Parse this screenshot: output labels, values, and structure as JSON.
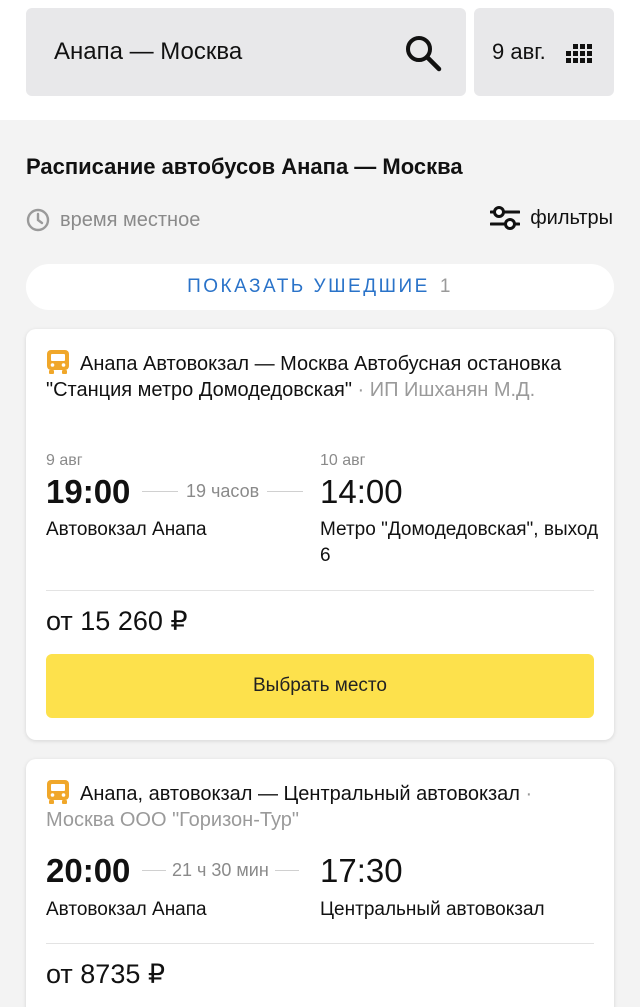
{
  "search": {
    "route": "Анапа — Москва",
    "date": "9 авг."
  },
  "page": {
    "title": "Расписание автобусов Анапа — Москва",
    "local_time": "время местное",
    "filters": "фильтры"
  },
  "departed": {
    "label": "ПОКАЗАТЬ УШЕДШИЕ",
    "count": "1"
  },
  "trips": [
    {
      "route": "Анапа Автовокзал — Москва Автобусная остановка \"Станция метро Домодедовская\"",
      "carrier": " · ИП Ишханян М.Д.",
      "dep_date": "9 авг",
      "dep_time": "19:00",
      "duration": "19 часов",
      "arr_date": "10 авг",
      "arr_time": "14:00",
      "dep_station": "Автовокзал Анапа",
      "arr_station": "Метро \"Домодедовская\", выход 6",
      "price": "от 15 260 ₽",
      "button": "Выбрать место"
    },
    {
      "route": "Анапа, автовокзал — Центральный автовокзал",
      "carrier": " · Москва ООО \"Горизон-Тур\"",
      "dep_time": "20:00",
      "duration": "21 ч 30 мин",
      "arr_time": "17:30",
      "dep_station": "Автовокзал Анапа",
      "arr_station": "Центральный автовокзал",
      "price": "от 8735 ₽"
    }
  ],
  "colors": {
    "accent": "#2a73c9",
    "button": "#fde14c",
    "bus_icon": "#f0a72a",
    "muted": "#8a8a8a"
  }
}
